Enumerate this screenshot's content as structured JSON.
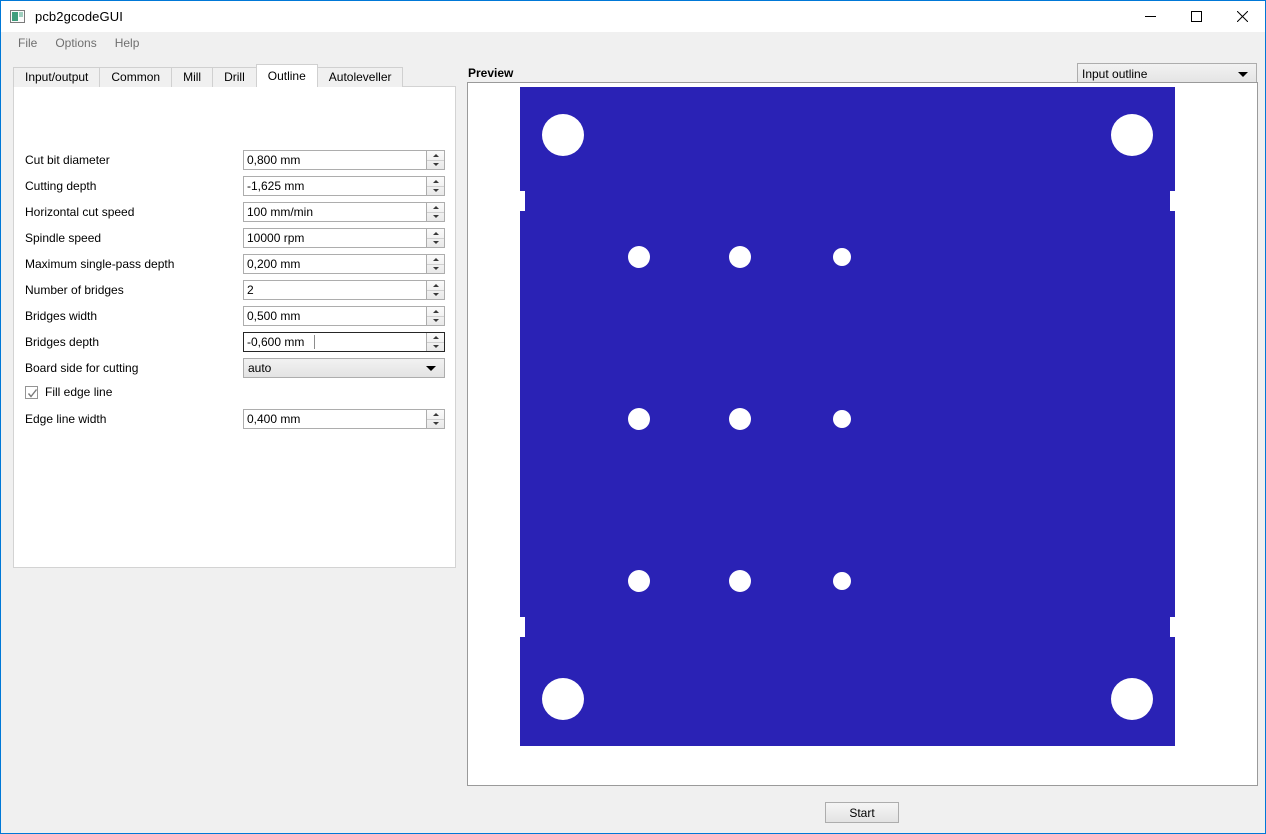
{
  "window": {
    "title": "pcb2gcodeGUI",
    "icon": "application-icon",
    "controls": {
      "minimize": "minimize-icon",
      "maximize": "maximize-icon",
      "close": "close-icon"
    }
  },
  "menu": {
    "items": [
      "File",
      "Options",
      "Help"
    ]
  },
  "tabs": [
    {
      "label": "Input/output",
      "active": false
    },
    {
      "label": "Common",
      "active": false
    },
    {
      "label": "Mill",
      "active": false
    },
    {
      "label": "Drill",
      "active": false
    },
    {
      "label": "Outline",
      "active": true
    },
    {
      "label": "Autoleveller",
      "active": false
    }
  ],
  "outline_form": {
    "fields": [
      {
        "label": "Cut bit diameter",
        "value": "0,800 mm",
        "type": "spinbox",
        "focused": false
      },
      {
        "label": "Cutting depth",
        "value": "-1,625 mm",
        "type": "spinbox",
        "focused": false
      },
      {
        "label": "Horizontal cut speed",
        "value": "100 mm/min",
        "type": "spinbox",
        "focused": false
      },
      {
        "label": "Spindle speed",
        "value": "10000 rpm",
        "type": "spinbox",
        "focused": false
      },
      {
        "label": "Maximum single-pass depth",
        "value": "0,200 mm",
        "type": "spinbox",
        "focused": false
      },
      {
        "label": "Number of bridges",
        "value": "2",
        "type": "spinbox",
        "focused": false
      },
      {
        "label": "Bridges width",
        "value": "0,500 mm",
        "type": "spinbox",
        "focused": false
      },
      {
        "label": "Bridges depth",
        "value": "-0,600 mm",
        "type": "spinbox",
        "focused": true
      },
      {
        "label": "Board side for cutting",
        "value": "auto",
        "type": "combobox",
        "focused": false
      }
    ],
    "checkbox": {
      "label": "Fill edge line",
      "checked": true
    },
    "edge_line": {
      "label": "Edge line width",
      "value": "0,400 mm",
      "type": "spinbox"
    }
  },
  "preview": {
    "title": "Preview",
    "mode": "Input outline",
    "board_color": "#2a22b5",
    "background_color": "#ffffff"
  },
  "actions": {
    "start": "Start"
  }
}
